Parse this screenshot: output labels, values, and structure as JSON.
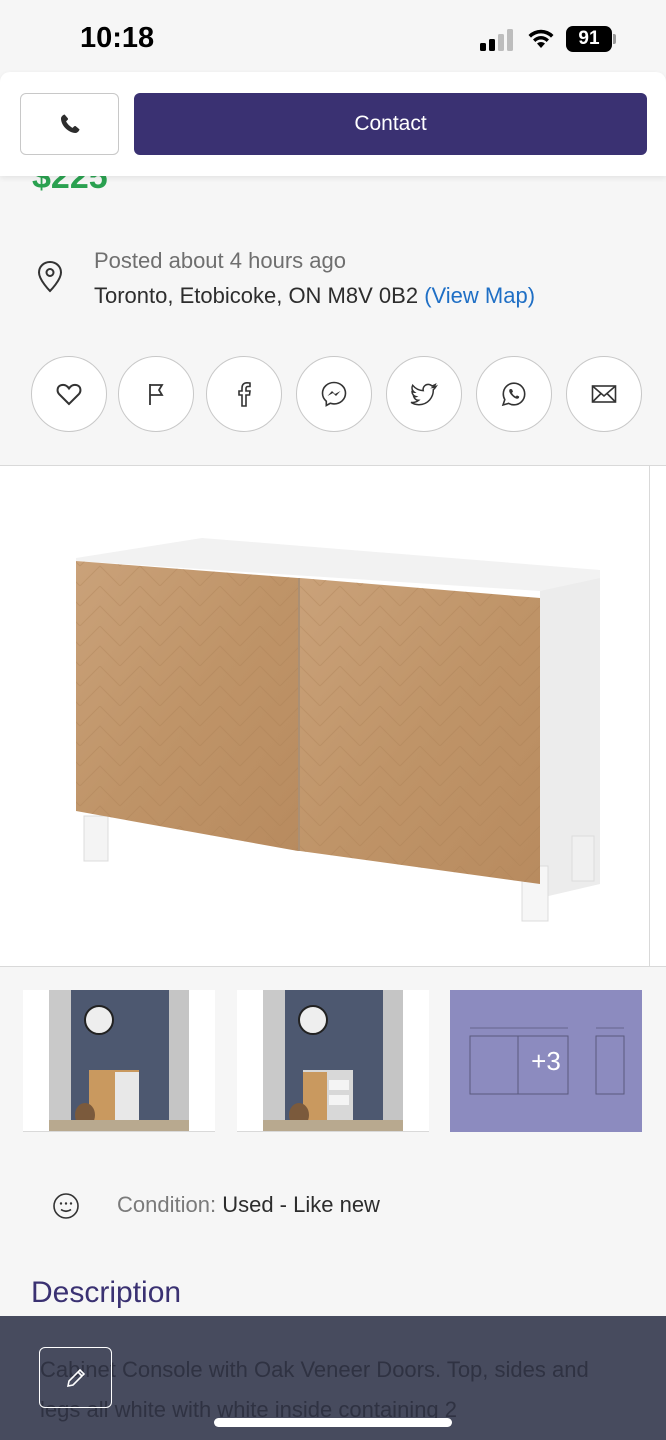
{
  "status": {
    "time": "10:18",
    "battery": "91"
  },
  "actions": {
    "phone_icon": "phone-icon",
    "contact_label": "Contact"
  },
  "listing": {
    "price": "$225",
    "posted": "Posted about 4 hours ago",
    "location": "Toronto, Etobicoke, ON M8V 0B2",
    "view_map": "(View Map)"
  },
  "share": [
    "heart-icon",
    "flag-icon",
    "facebook-icon",
    "messenger-icon",
    "twitter-icon",
    "whatsapp-icon",
    "mail-icon"
  ],
  "gallery": {
    "more_count": "+3"
  },
  "condition": {
    "label": "Condition:",
    "value": "Used - Like new"
  },
  "description": {
    "heading": "Description",
    "text": "Cabinet Console with Oak Veneer Doors. Top, sides and legs all white with white inside containing 2"
  },
  "colors": {
    "accent": "#3a3172",
    "price": "#2aa150",
    "link": "#1f6fc5"
  }
}
